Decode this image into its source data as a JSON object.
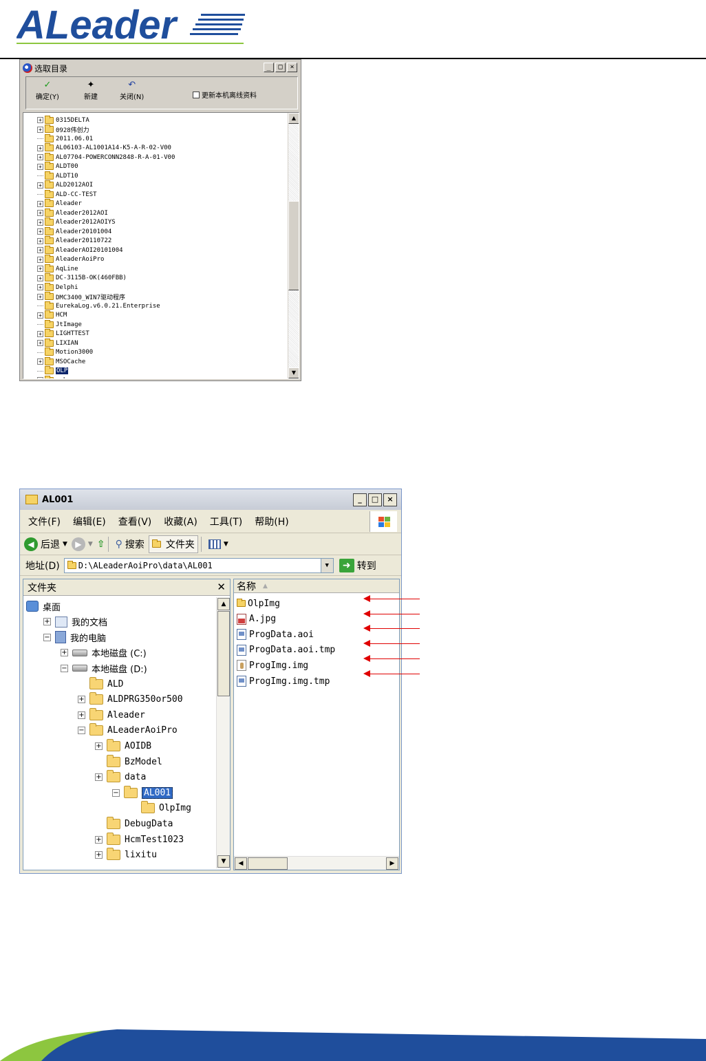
{
  "logo": {
    "text": "ALeader"
  },
  "dialog": {
    "title": "选取目录",
    "caption_buttons": [
      "_",
      "□",
      "×"
    ],
    "toolbar": {
      "confirm_label": "确定(Y)",
      "new_label": "新建",
      "close_label": "关闭(N)",
      "checkbox_label": "更新本机离线资料",
      "checkbox_checked": false
    },
    "tree_items": [
      {
        "label": "0315DELTA",
        "expander": "+"
      },
      {
        "label": "0928伟创力",
        "expander": "+"
      },
      {
        "label": "2011.06.01",
        "expander": ""
      },
      {
        "label": "AL06103-AL1001A14-K5-A-R-02-V00",
        "expander": "+"
      },
      {
        "label": "AL07704-POWERCONN2848-R-A-01-V00",
        "expander": "+"
      },
      {
        "label": "ALDT00",
        "expander": "+"
      },
      {
        "label": "ALDT10",
        "expander": ""
      },
      {
        "label": "ALD2012AOI",
        "expander": "+"
      },
      {
        "label": "ALD-CC-TEST",
        "expander": ""
      },
      {
        "label": "Aleader",
        "expander": "+"
      },
      {
        "label": "Aleader2012AOI",
        "expander": "+"
      },
      {
        "label": "Aleader2012AOIYS",
        "expander": "+"
      },
      {
        "label": "Aleader20101004",
        "expander": "+"
      },
      {
        "label": "Aleader20110722",
        "expander": "+"
      },
      {
        "label": "AleaderAOI20101004",
        "expander": "+"
      },
      {
        "label": "AleaderAoiPro",
        "expander": "+"
      },
      {
        "label": "AqLine",
        "expander": "+"
      },
      {
        "label": "DC-3115B-OK(460FBB)",
        "expander": "+"
      },
      {
        "label": "Delphi",
        "expander": "+"
      },
      {
        "label": "DMC3400_WIN7驱动程序",
        "expander": "+"
      },
      {
        "label": "EurekaLog.v6.0.21.Enterprise",
        "expander": ""
      },
      {
        "label": "HCM",
        "expander": "+"
      },
      {
        "label": "JtImage",
        "expander": ""
      },
      {
        "label": "LIGHTTEST",
        "expander": "+"
      },
      {
        "label": "LIXIAN",
        "expander": "+"
      },
      {
        "label": "Motion3000",
        "expander": ""
      },
      {
        "label": "MSOCache",
        "expander": "+"
      },
      {
        "label": "OLP",
        "expander": "",
        "selected": true
      },
      {
        "label": "cxh",
        "expander": "+"
      }
    ]
  },
  "explorer": {
    "title": "AL001",
    "menu": [
      "文件(F)",
      "编辑(E)",
      "查看(V)",
      "收藏(A)",
      "工具(T)",
      "帮助(H)"
    ],
    "toolbar": {
      "back": "后退",
      "search": "搜索",
      "folders": "文件夹"
    },
    "address": {
      "label": "地址(D)",
      "value": "D:\\ALeaderAoiPro\\data\\AL001",
      "go": "转到"
    },
    "folder_pane": {
      "header": "文件夹",
      "items": [
        {
          "label": "桌面",
          "level": 0,
          "expander": "",
          "icon": "desktop-icon"
        },
        {
          "label": "我的文档",
          "level": 1,
          "expander": "+",
          "icon": "my-documents-icon"
        },
        {
          "label": "我的电脑",
          "level": 1,
          "expander": "−",
          "icon": "my-computer-icon"
        },
        {
          "label": "本地磁盘 (C:)",
          "level": 2,
          "expander": "+",
          "icon": "drive-icon"
        },
        {
          "label": "本地磁盘 (D:)",
          "level": 2,
          "expander": "−",
          "icon": "drive-icon"
        },
        {
          "label": "ALD",
          "level": 3,
          "expander": "",
          "icon": "folder-icon"
        },
        {
          "label": "ALDPRG350or500",
          "level": 3,
          "expander": "+",
          "icon": "folder-icon"
        },
        {
          "label": "Aleader",
          "level": 3,
          "expander": "+",
          "icon": "folder-icon"
        },
        {
          "label": "ALeaderAoiPro",
          "level": 3,
          "expander": "−",
          "icon": "folder-icon"
        },
        {
          "label": "AOIDB",
          "level": 4,
          "expander": "+",
          "icon": "folder-icon"
        },
        {
          "label": "BzModel",
          "level": 4,
          "expander": "",
          "icon": "folder-icon"
        },
        {
          "label": "data",
          "level": 4,
          "expander": "+",
          "icon": "folder-icon"
        },
        {
          "label": "AL001",
          "level": 5,
          "expander": "−",
          "icon": "folder-icon",
          "selected": true
        },
        {
          "label": "OlpImg",
          "level": 6,
          "expander": "",
          "icon": "folder-icon"
        },
        {
          "label": "DebugData",
          "level": 4,
          "expander": "",
          "icon": "folder-icon"
        },
        {
          "label": "HcmTest1023",
          "level": 4,
          "expander": "+",
          "icon": "folder-icon"
        },
        {
          "label": "lixitu",
          "level": 4,
          "expander": "+",
          "icon": "folder-icon"
        }
      ]
    },
    "file_pane": {
      "column_name": "名称",
      "files": [
        {
          "name": "OlpImg",
          "icon": "folder-icon"
        },
        {
          "name": "A.jpg",
          "icon": "jpg-file-icon"
        },
        {
          "name": "ProgData.aoi",
          "icon": "data-file-icon"
        },
        {
          "name": "ProgData.aoi.tmp",
          "icon": "data-file-icon"
        },
        {
          "name": "ProgImg.img",
          "icon": "img-file-icon"
        },
        {
          "name": "ProgImg.img.tmp",
          "icon": "data-file-icon"
        }
      ]
    }
  },
  "colors": {
    "arrow": "#e00000",
    "brand_blue": "#1f4e9c",
    "brand_green": "#8dc63f"
  }
}
